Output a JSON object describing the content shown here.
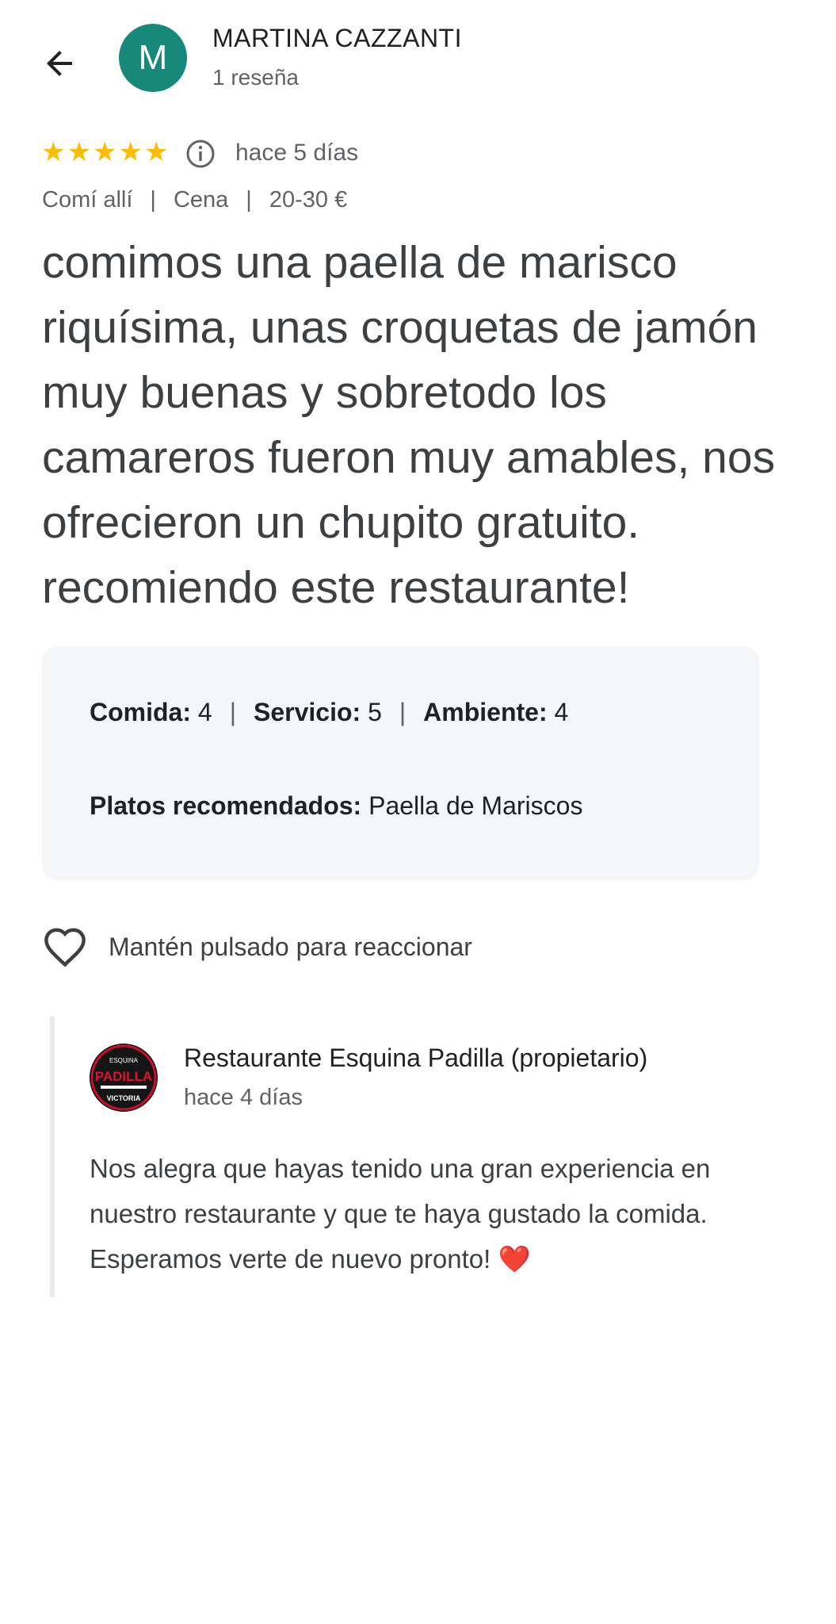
{
  "header": {
    "back_icon": "arrow-back-icon",
    "avatar_letter": "M",
    "avatar_color": "#16897b",
    "author_name": "MARTINA CAZZANTI",
    "author_reviews": "1 reseña"
  },
  "rating": {
    "stars": 5,
    "star_color": "#fbbc04",
    "info_icon": "info-icon",
    "time": "hace 5 días"
  },
  "meta": {
    "type": "Comí allí",
    "meal": "Cena",
    "price": "20-30 €",
    "separator": "|"
  },
  "review": {
    "text": "comimos una paella de marisco riquísima, unas croquetas de jamón muy buenas y sobretodo los camareros fueron muy amables, nos ofrecieron un chupito gratuito. recomiendo este restaurante!"
  },
  "scores": {
    "food_label": "Comida:",
    "food_value": "4",
    "service_label": "Servicio:",
    "service_value": "5",
    "ambience_label": "Ambiente:",
    "ambience_value": "4",
    "separator": "|",
    "dishes_label": "Platos recomendados:",
    "dishes_value": "Paella de Mariscos"
  },
  "reaction": {
    "icon": "heart-outline-icon",
    "label": "Mantén pulsado para reaccionar"
  },
  "owner_reply": {
    "logo_text_top": "ESQUINA",
    "logo_text_main": "PADILLA",
    "logo_text_bottom": "VICTORIA",
    "name": "Restaurante Esquina Padilla (propietario)",
    "time": "hace 4 días",
    "text": "Nos alegra que hayas tenido una gran experiencia en nuestro restaurante y que te haya gustado la comida. Esperamos verte de nuevo pronto! ❤️"
  }
}
